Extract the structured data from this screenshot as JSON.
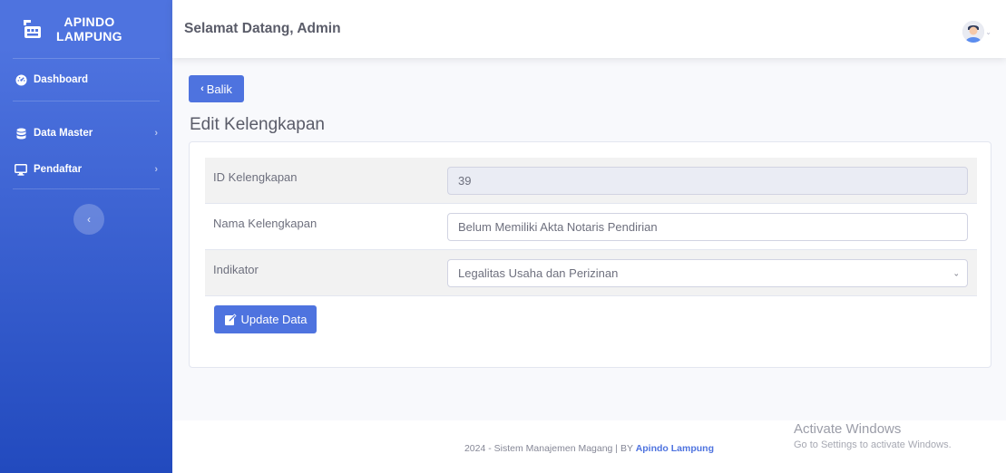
{
  "sidebar": {
    "brand_line1": "APINDO",
    "brand_line2": "LAMPUNG",
    "items": [
      {
        "label": "Dashboard",
        "icon": "tachometer-icon"
      },
      {
        "label": "Data Master",
        "icon": "database-icon"
      },
      {
        "label": "Pendaftar",
        "icon": "desktop-icon"
      }
    ]
  },
  "topbar": {
    "welcome": "Selamat Datang, Admin"
  },
  "main": {
    "back_label": "Balik",
    "title": "Edit Kelengkapan",
    "form": {
      "id_label": "ID Kelengkapan",
      "id_value": "39",
      "nama_label": "Nama Kelengkapan",
      "nama_value": "Belum Memiliki Akta Notaris Pendirian",
      "indikator_label": "Indikator",
      "indikator_value": "Legalitas Usaha dan Perizinan"
    },
    "update_label": "Update Data"
  },
  "footer": {
    "text": "2024 - Sistem Manajemen Magang | BY ",
    "link": "Apindo Lampung"
  },
  "watermark": {
    "title": "Activate Windows",
    "subtitle": "Go to Settings to activate Windows."
  },
  "colors": {
    "primary": "#4e73df",
    "sidebar_bottom": "#224abe",
    "text": "#5a5c69"
  }
}
